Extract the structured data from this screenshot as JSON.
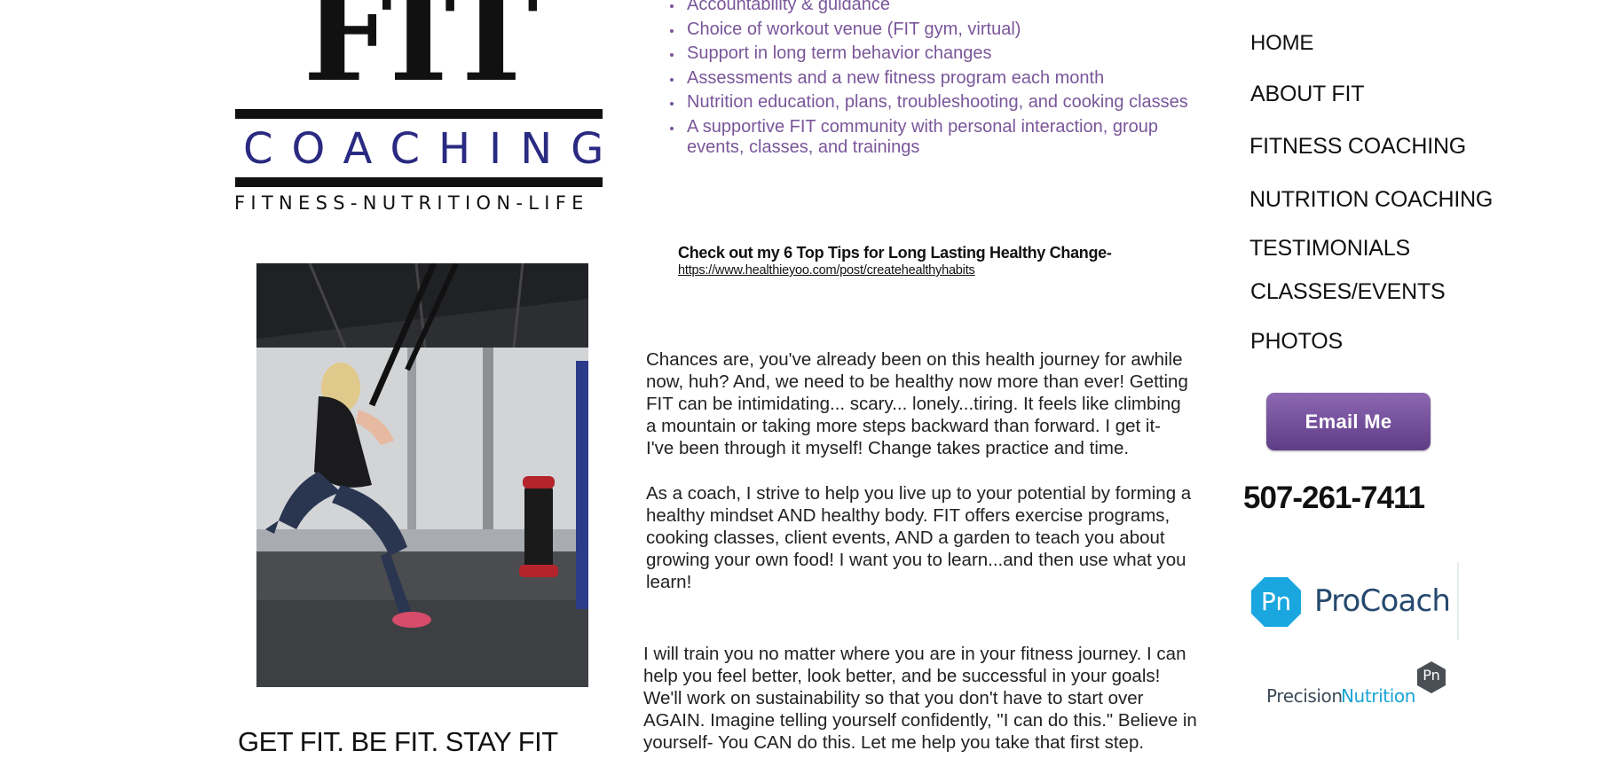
{
  "logo": {
    "wordmark": "FIT",
    "subtitle": "COACHING",
    "tagline": "FITNESS-NUTRITION-LIFE"
  },
  "slogan": "GET FIT. BE FIT. STAY FIT",
  "benefits": [
    "Accountability & guidance",
    "Choice of workout venue (FIT gym, virtual)",
    "Support in long term behavior changes",
    "Assessments and a new fitness program each month",
    "Nutrition education, plans, troubleshooting, and cooking classes",
    "A supportive FIT community with personal interaction, group events, classes, and trainings"
  ],
  "tips": {
    "heading": "Check out my 6 Top Tips for Long Lasting Healthy Change-",
    "link": "https://www.healthieyoo.com/post/createhealthyhabits"
  },
  "paragraphs": [
    "Chances are, you've already been on this health journey for awhile now, huh?  And, we need to be healthy now more than ever!  Getting FIT can be intimidating... scary... lonely...tiring.  It feels like climbing a mountain or taking more steps backward than forward.  I get it- I've been through it myself!  Change takes practice and time.",
    "As a coach, I strive to help you live up to your potential by forming a healthy mindset AND healthy body.  FIT offers exercise programs, cooking classes, client events, AND a garden to teach you about growing your own food!  I want you to learn...and then use what you learn!",
    "I will train you no matter where you are in your fitness journey.  I can help you feel better, look better, and be successful in your goals!  We'll work on sustainability so that you don't have to start over AGAIN.  Imagine telling yourself confidently, \"I can do this.\"  Believe in yourself- You CAN do this. Let me help you take that first step."
  ],
  "nav": {
    "home": "HOME",
    "about": "ABOUT FIT",
    "fitness": "FITNESS COACHING",
    "nutrition": "NUTRITION COACHING",
    "testimonials": "TESTIMONIALS",
    "classes": "CLASSES/EVENTS",
    "photos": "PHOTOS"
  },
  "contact": {
    "email_button": "Email Me",
    "phone": "507-261-7411"
  },
  "badges": {
    "procoach_mark": "Pn",
    "procoach_name": "ProCoach",
    "pn_word1": "Precision",
    "pn_word2": "Nutrition",
    "pn_mark": "Pn"
  },
  "colors": {
    "benefit_text": "#7a569a",
    "button_purple": "#6f4b97",
    "logo_blue": "#2a2a82",
    "procoach_cyan": "#1aa7e0",
    "procoach_navy": "#26496e"
  }
}
